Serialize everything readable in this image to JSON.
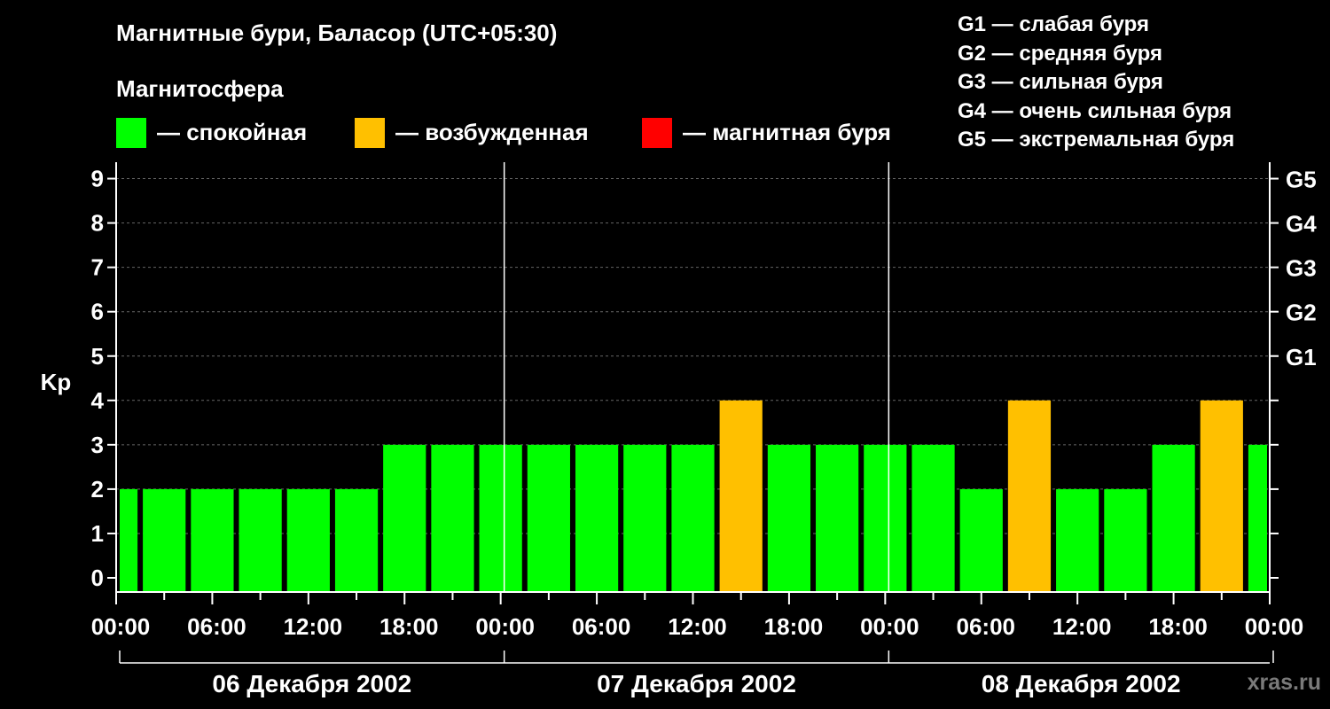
{
  "title": "Магнитные бури, Баласор (UTC+05:30)",
  "magnetosphere_title": "Магнитосфера",
  "legend": [
    {
      "label": "— спокойная",
      "color": "#00FF00"
    },
    {
      "label": "— возбужденная",
      "color": "#FFC000"
    },
    {
      "label": "— магнитная буря",
      "color": "#FF0000"
    }
  ],
  "g_scale": [
    "G1 — слабая буря",
    "G2 — средняя буря",
    "G3 — сильная буря",
    "G4 — очень сильная буря",
    "G5 — экстремальная буря"
  ],
  "watermark": "xras.ru",
  "chart_data": {
    "type": "bar",
    "ylabel": "Kp",
    "ylim": [
      0,
      9
    ],
    "y_ticks": [
      "0",
      "1",
      "2",
      "3",
      "4",
      "5",
      "6",
      "7",
      "8",
      "9"
    ],
    "right_axis": [
      {
        "value": 5,
        "label": "G1"
      },
      {
        "value": 6,
        "label": "G2"
      },
      {
        "value": 7,
        "label": "G3"
      },
      {
        "value": 8,
        "label": "G4"
      },
      {
        "value": 9,
        "label": "G5"
      }
    ],
    "x_ticks": [
      "00:00",
      "06:00",
      "12:00",
      "18:00",
      "00:00",
      "06:00",
      "12:00",
      "18:00",
      "00:00",
      "06:00",
      "12:00",
      "18:00",
      "00:00"
    ],
    "days": [
      "06 Декабря 2002",
      "07 Декабря 2002",
      "08 Декабря 2002"
    ],
    "grid": "horizontal dashed",
    "series": [
      {
        "values": [
          2,
          2,
          2,
          2,
          2,
          2,
          3,
          3,
          3,
          3,
          3,
          3,
          3,
          4,
          3,
          3,
          3,
          3,
          2,
          4,
          2,
          2,
          3,
          4,
          3
        ],
        "colors": [
          "#00FF00",
          "#00FF00",
          "#00FF00",
          "#00FF00",
          "#00FF00",
          "#00FF00",
          "#00FF00",
          "#00FF00",
          "#00FF00",
          "#00FF00",
          "#00FF00",
          "#00FF00",
          "#00FF00",
          "#FFC000",
          "#00FF00",
          "#00FF00",
          "#00FF00",
          "#00FF00",
          "#00FF00",
          "#FFC000",
          "#00FF00",
          "#00FF00",
          "#00FF00",
          "#FFC000",
          "#00FF00"
        ]
      }
    ]
  }
}
